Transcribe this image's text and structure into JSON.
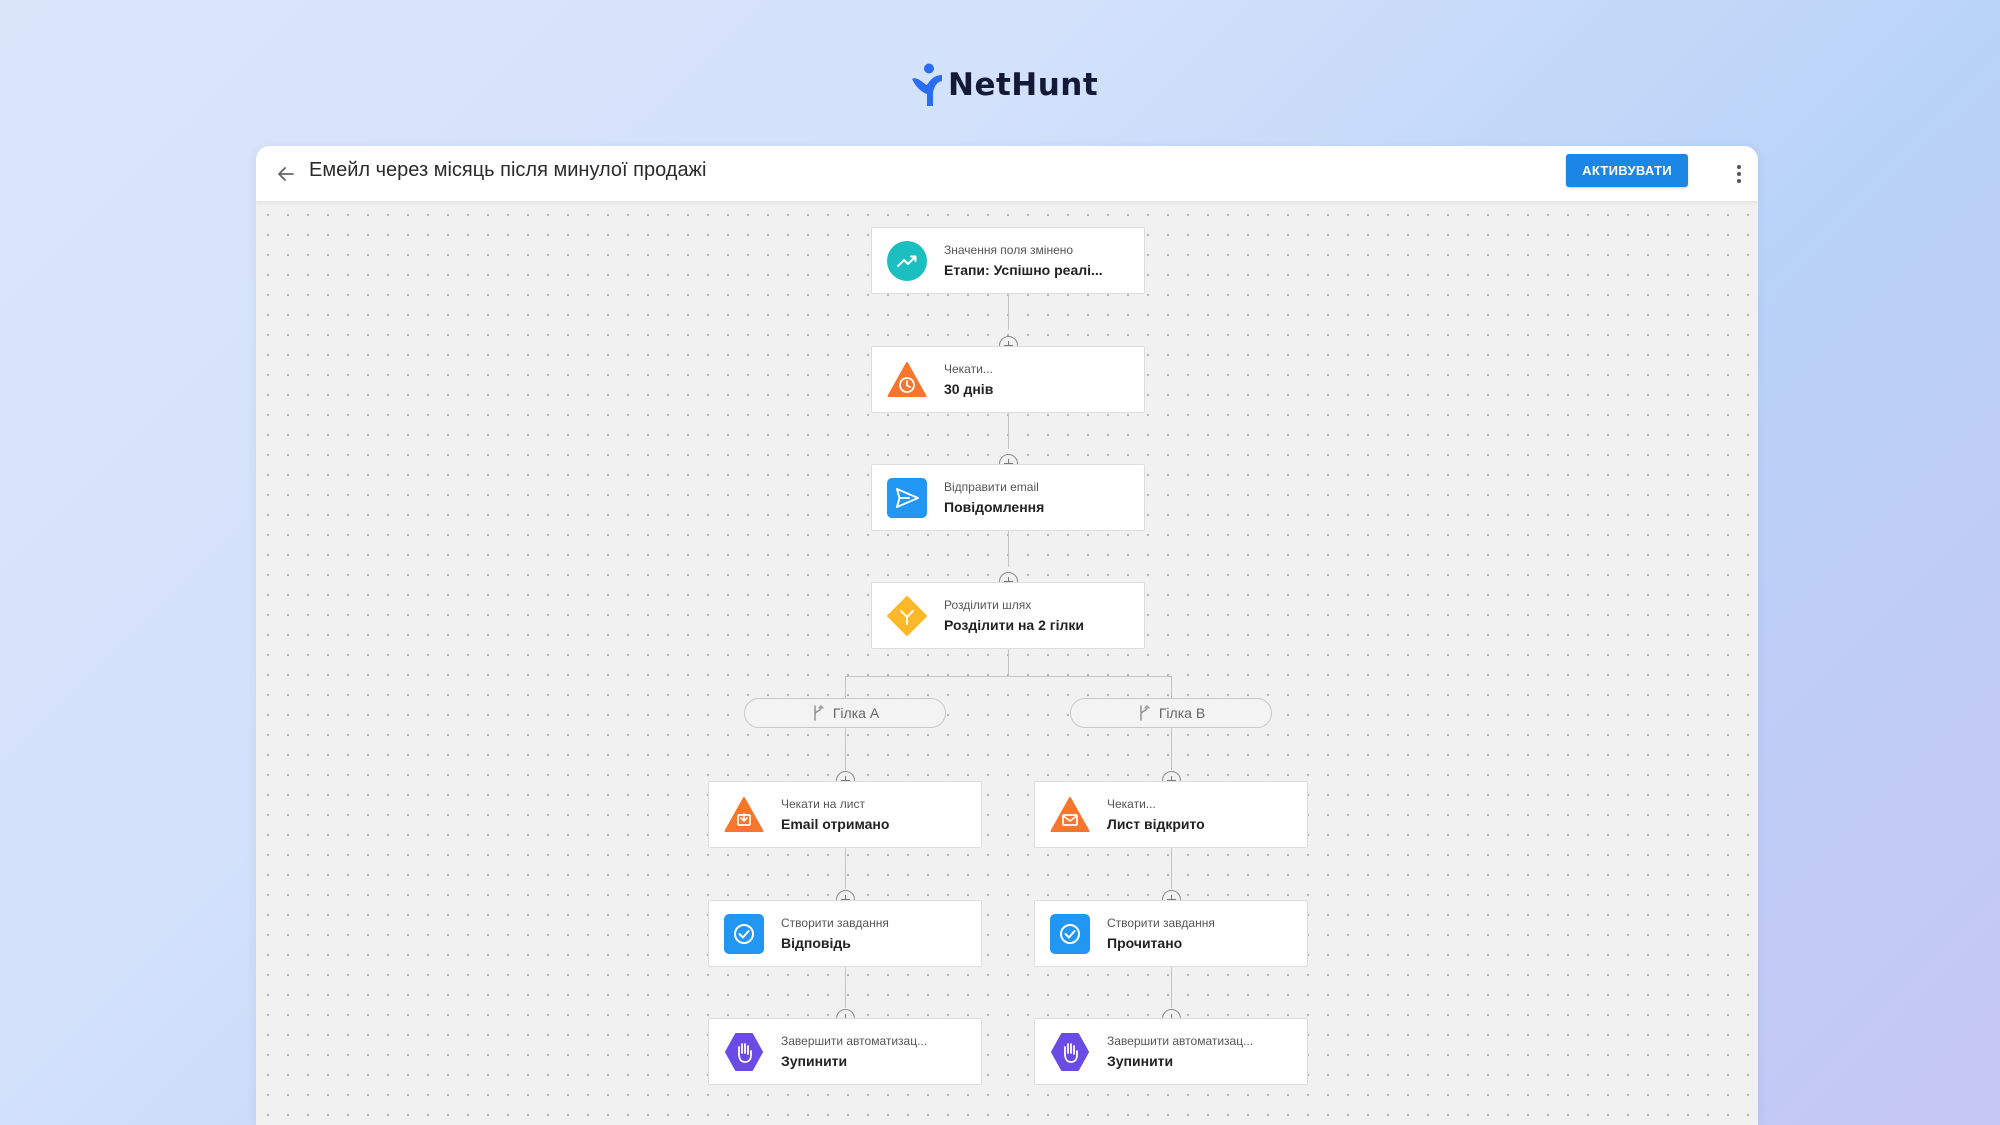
{
  "brand": {
    "name": "NetHunt",
    "mark_color": "#2a6df0",
    "text_color": "#141a35"
  },
  "header": {
    "back_icon": "arrow-left-icon",
    "title": "Емейл через місяць після минулої продажі",
    "activate_label": "АКТИВУВАТИ",
    "more_icon": "more-vertical-icon",
    "accent": "#1b86e6"
  },
  "workflow": {
    "steps": [
      {
        "type": "Значення поля змінено",
        "value": "Етапи: Успішно реалі...",
        "icon": "trending-up-icon",
        "color": "#1cbfc0"
      },
      {
        "type": "Чекати...",
        "value": "30 днів",
        "icon": "clock-warning-icon",
        "color": "#f7762d"
      },
      {
        "type": "Відправити email",
        "value": "Повідомлення",
        "icon": "send-icon",
        "color": "#2196f3"
      },
      {
        "type": "Розділити шлях",
        "value": "Розділити на 2 гілки",
        "icon": "split-icon",
        "color": "#fbb929"
      }
    ],
    "branches": [
      {
        "label": "Гілка A",
        "steps": [
          {
            "type": "Чекати на лист",
            "value": "Email отримано",
            "icon": "inbox-warning-icon",
            "color": "#f7762d"
          },
          {
            "type": "Створити завдання",
            "value": "Відповідь",
            "icon": "task-check-icon",
            "color": "#2196f3"
          },
          {
            "type": "Завершити автоматизац...",
            "value": "Зупинити",
            "icon": "stop-hand-icon",
            "color": "#6a4be6"
          }
        ]
      },
      {
        "label": "Гілка B",
        "steps": [
          {
            "type": "Чекати...",
            "value": "Лист відкрито",
            "icon": "mail-warning-icon",
            "color": "#f7762d"
          },
          {
            "type": "Створити завдання",
            "value": "Прочитано",
            "icon": "task-check-icon",
            "color": "#2196f3"
          },
          {
            "type": "Завершити автоматизац...",
            "value": "Зупинити",
            "icon": "stop-hand-icon",
            "color": "#6a4be6"
          }
        ]
      }
    ]
  }
}
